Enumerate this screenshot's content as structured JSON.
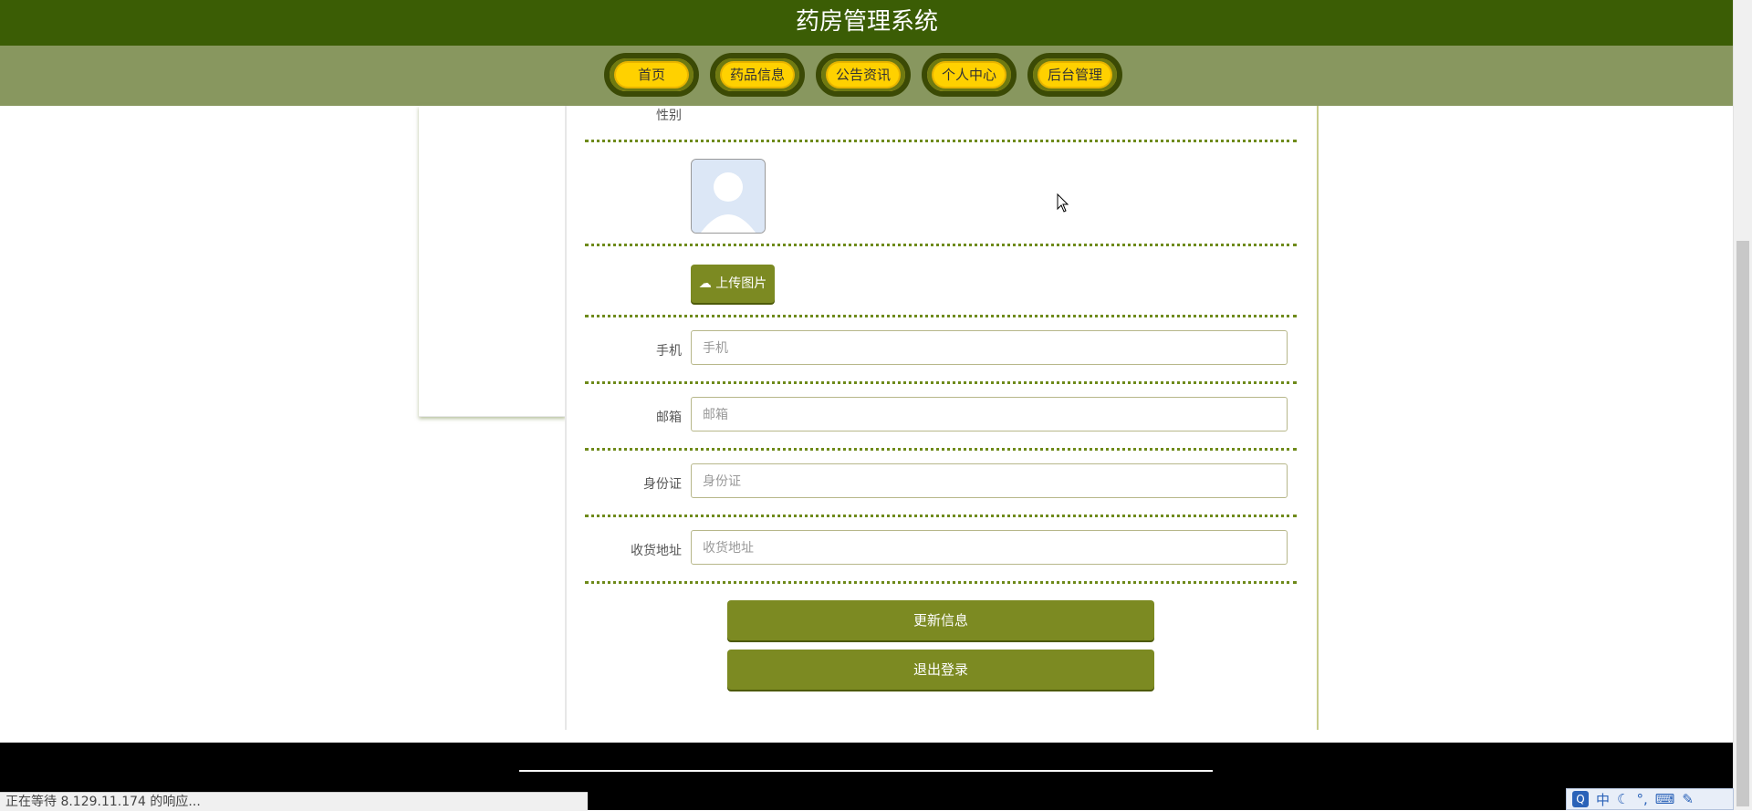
{
  "header": {
    "title": "药房管理系统"
  },
  "nav": {
    "items": [
      {
        "label": "首页"
      },
      {
        "label": "药品信息"
      },
      {
        "label": "公告资讯"
      },
      {
        "label": "个人中心"
      },
      {
        "label": "后台管理"
      }
    ]
  },
  "form": {
    "gender_label": "性别",
    "upload_label": "上传图片",
    "phone": {
      "label": "手机",
      "placeholder": "手机"
    },
    "email": {
      "label": "邮箱",
      "placeholder": "邮箱"
    },
    "idcard": {
      "label": "身份证",
      "placeholder": "身份证"
    },
    "address": {
      "label": "收货地址",
      "placeholder": "收货地址"
    },
    "update_button": "更新信息",
    "logout_button": "退出登录"
  },
  "browser": {
    "status_text": "正在等待 8.129.11.174 的响应..."
  },
  "ime": {
    "mode_label": "中"
  },
  "colors": {
    "header_bg": "#3b5d05",
    "nav_bg": "#88975f",
    "button_bg": "#7c8a22",
    "nav_button": "#ffd100"
  }
}
